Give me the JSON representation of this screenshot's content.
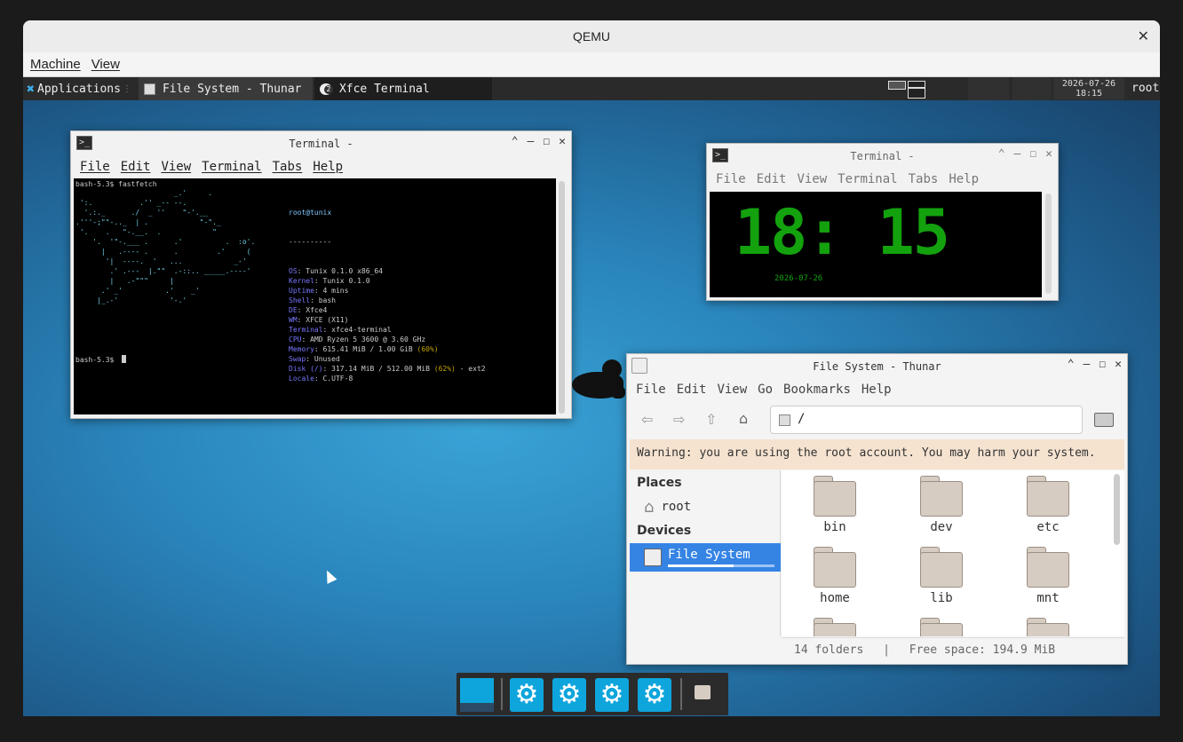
{
  "qemu": {
    "title": "QEMU",
    "menu": [
      "Machine",
      "View"
    ]
  },
  "panel": {
    "applications": "Applications",
    "tasks": [
      "File System - Thunar",
      "Xfce Terminal"
    ],
    "task_badge": "2",
    "date": "2026-07-26",
    "time": "18:15",
    "user": "root"
  },
  "terminal1": {
    "title": "Terminal -",
    "menu": [
      "File",
      "Edit",
      "View",
      "Terminal",
      "Tabs",
      "Help"
    ],
    "prompt1": "bash-5.3$ fastfetch",
    "prompt2": "bash-5.3$",
    "header": "root@tunix",
    "separator": "----------",
    "info": [
      {
        "k": "OS",
        "v": "Tunix 0.1.0 x86_64"
      },
      {
        "k": "Kernel",
        "v": "Tunix 0.1.0"
      },
      {
        "k": "Uptime",
        "v": "4 mins"
      },
      {
        "k": "Shell",
        "v": "bash"
      },
      {
        "k": "DE",
        "v": "Xfce4"
      },
      {
        "k": "WM",
        "v": "XFCE (X11)"
      },
      {
        "k": "Terminal",
        "v": "xfce4-terminal"
      },
      {
        "k": "CPU",
        "v": "AMD Ryzen 5 3600 @ 3.60 GHz"
      },
      {
        "k": "Memory",
        "v": "615.41 MiB / 1.00 GiB",
        "pct": "(60%)"
      },
      {
        "k": "Swap",
        "v": "Unused"
      },
      {
        "k": "Disk (/)",
        "v": "317.14 MiB / 512.00 MiB",
        "pct": "(62%)",
        "tail": "- ext2"
      },
      {
        "k": "Locale",
        "v": "C.UTF-8"
      }
    ],
    "palette_top": [
      "#000000",
      "#cc0000",
      "#4e9a06",
      "#c4a000",
      "#3465a4",
      "#c031c0",
      "#06989a",
      "#d3d7cf"
    ],
    "palette_bottom": [
      "#555753",
      "#ef2929",
      "#8ae234",
      "#fce94f",
      "#729fcf",
      "#ad7fa8",
      "#34e2e2",
      "#ffffff"
    ]
  },
  "terminal2": {
    "title": "Terminal -",
    "menu": [
      "File",
      "Edit",
      "View",
      "Terminal",
      "Tabs",
      "Help"
    ],
    "clock": "18: 15",
    "date": "2026-07-26"
  },
  "thunar": {
    "title": "File System - Thunar",
    "menu": [
      "File",
      "Edit",
      "View",
      "Go",
      "Bookmarks",
      "Help"
    ],
    "path": "/",
    "warning": "Warning: you are using the root account. You may harm your system.",
    "places_header": "Places",
    "places": [
      "root"
    ],
    "devices_header": "Devices",
    "devices": [
      "File System"
    ],
    "folders": [
      "bin",
      "dev",
      "etc",
      "home",
      "lib",
      "mnt"
    ],
    "status_count": "14 folders",
    "status_sep": "|",
    "status_free": "Free space: 194.9 MiB"
  },
  "colors": {
    "accent": "#3584e4",
    "dock_icon": "#0ea5dc",
    "clock_green": "#13a10e"
  }
}
